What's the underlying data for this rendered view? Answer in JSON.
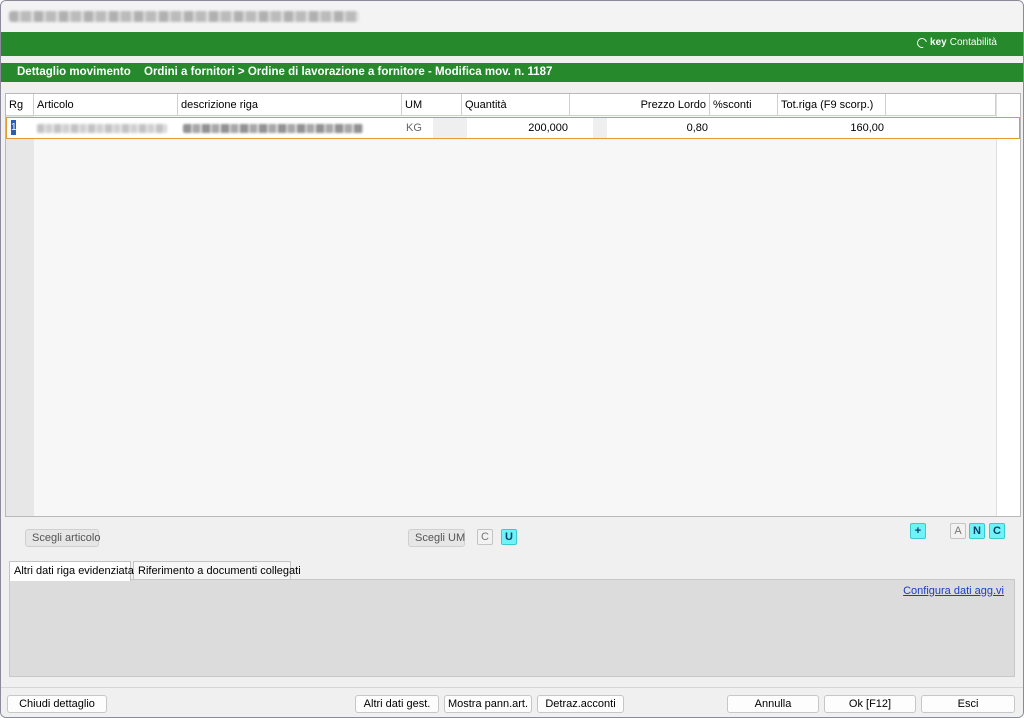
{
  "brand": {
    "prefix": "key",
    "suffix": "Contabilità"
  },
  "subheader": {
    "section": "Dettaglio movimento",
    "path": "Ordini a fornitori > Ordine di lavorazione a fornitore - Modifica mov. n. 1187"
  },
  "grid": {
    "columns": [
      "Rg",
      "Articolo",
      "descrizione riga",
      "UM",
      "Quantità",
      "Prezzo Lordo",
      "%sconti",
      "Tot.riga (F9 scorp.)"
    ],
    "rows": [
      {
        "rg": "1",
        "um": "KG",
        "quantita": "200,000",
        "prezzo_lordo": "0,80",
        "sconti": "",
        "tot_riga": "160,00"
      }
    ]
  },
  "actions": {
    "scegli_articolo": "Scegli articolo",
    "scegli_um": "Scegli UM",
    "c": "C",
    "u": "U",
    "plus": "+",
    "a": "A",
    "n": "N",
    "c2": "C"
  },
  "tabs": [
    "Altri dati riga evidenziata",
    "Riferimento a documenti collegati"
  ],
  "panel": {
    "link": "Configura dati agg.vi"
  },
  "bottom": {
    "chiudi": "Chiudi dettaglio",
    "altri_dati": "Altri dati gest.",
    "mostra": "Mostra pann.art.",
    "detraz": "Detraz.acconti",
    "annulla": "Annulla",
    "ok": "Ok [F12]",
    "esci": "Esci"
  },
  "colors": {
    "green": "#26892c",
    "accent_cyan": "#6ef3f7",
    "row_border": "#e59a2f",
    "link": "#1a3cc7"
  }
}
